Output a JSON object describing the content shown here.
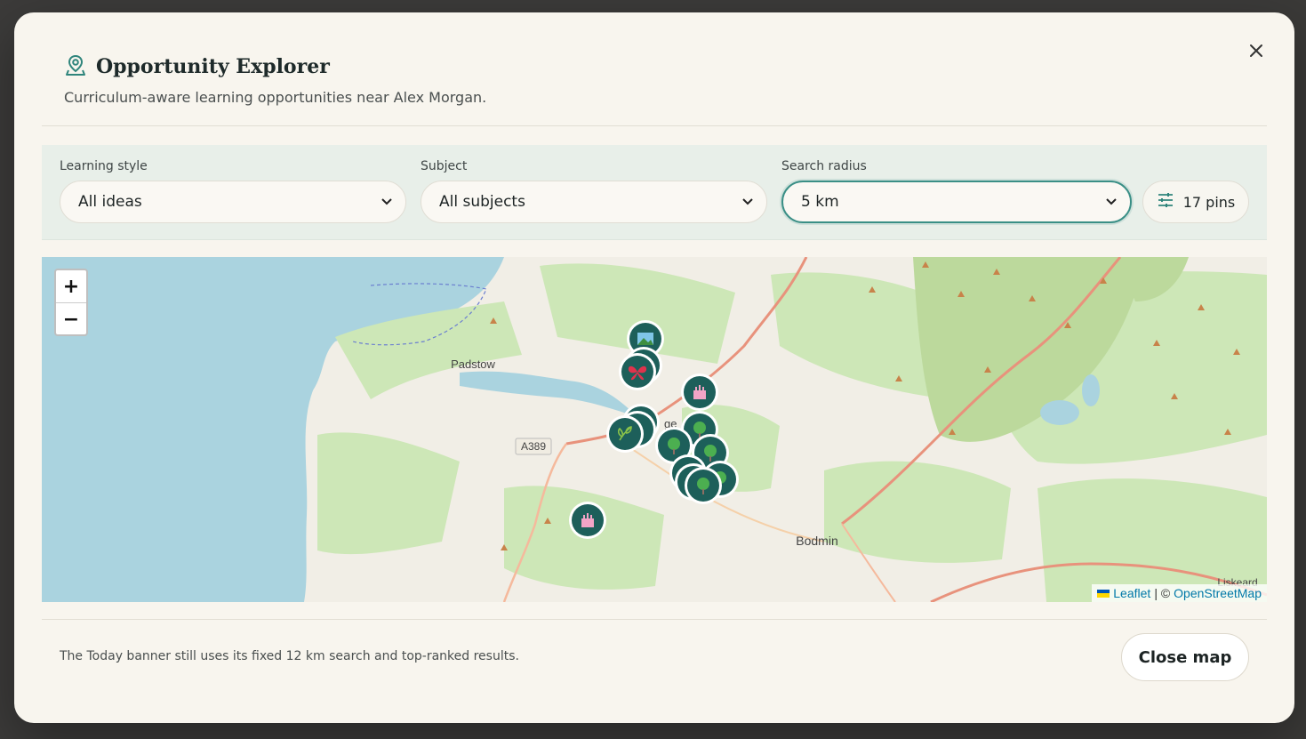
{
  "modal": {
    "title": "Opportunity Explorer",
    "subtitle": "Curriculum-aware learning opportunities near Alex Morgan.",
    "close_icon": "close-icon"
  },
  "filters": {
    "learning_style": {
      "label": "Learning style",
      "value": "All ideas"
    },
    "subject": {
      "label": "Subject",
      "value": "All subjects"
    },
    "radius": {
      "label": "Search radius",
      "value": "5 km"
    },
    "pins_label": "17 pins"
  },
  "map": {
    "zoom_in": "+",
    "zoom_out": "−",
    "places": {
      "padstow": "Padstow",
      "bodmin": "Bodmin",
      "liskeard": "Liskeard",
      "wadebridge_fragment": "ge",
      "road": "A389"
    },
    "attribution": {
      "leaflet": "Leaflet",
      "separator": "| ©",
      "osm": "OpenStreetMap"
    },
    "colors": {
      "sea": "#aad3df",
      "land": "#f1eee6",
      "green": "#cde7b7",
      "pin": "#1d5f5a",
      "accent": "#3a8f86"
    }
  },
  "footer": {
    "note": "The Today banner still uses its fixed 12 km search and top-ranked results.",
    "close_button": "Close map"
  }
}
